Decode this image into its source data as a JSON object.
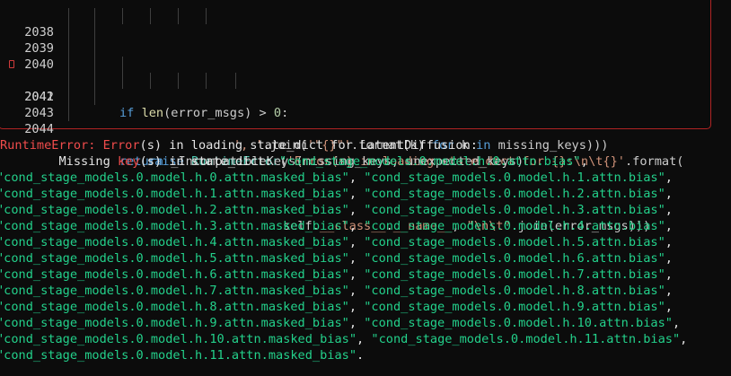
{
  "colors": {
    "border": "#b02424",
    "keyword": "#569cd6",
    "string": "#ce9178",
    "builtin": "#dcdcaa",
    "class": "#4ec9b0",
    "error": "#f14c4c",
    "key_string": "#23d18b"
  },
  "traceback": {
    "lines": [
      {
        "num": "2038",
        "seg": [
          "', '",
          ".join(",
          "'\"{}\"'",
          ".format(k) ",
          "for",
          " k ",
          "in",
          " missing_keys)))"
        ]
      },
      {
        "num": "2039"
      },
      {
        "num": "2040",
        "seg": [
          "if",
          " ",
          "len",
          "(error_msgs) > ",
          "0",
          ":"
        ]
      },
      {
        "num": "2041",
        "seg": [
          "raise",
          " ",
          "RuntimeError",
          "(",
          "'Error(s) in loading state_dict for {}:\\n\\t{}'",
          ".format("
        ]
      },
      {
        "num": "2042",
        "seg": [
          "self.",
          "__class__",
          ".",
          "__name__",
          ", ",
          "\"\\n\\t\"",
          ".join(error_msgs)))"
        ]
      },
      {
        "num": "2043",
        "seg": [
          "return",
          " _IncompatibleKeys(missing_keys, unexpected_keys)"
        ]
      },
      {
        "num": "2044"
      }
    ],
    "error_marker_icon": "error-marker-icon"
  },
  "output": {
    "error_type": "RuntimeError:",
    "error_word": "Error",
    "error_rest": "(s) in loading state_dict for LatentDiffusion:",
    "missing_prefix": "        Missing ",
    "missing_key": "key",
    "missing_rest": "(s) in state_dict: ",
    "first_key": "\"cond_stage_models.0.model.h.0.attn.bias\"",
    "first_tail": ",",
    "rows": [
      [
        "\"cond_stage_models.0.model.h.0.attn.masked_bias\"",
        ", ",
        "\"cond_stage_models.0.model.h.1.attn.bias\"",
        ","
      ],
      [
        "\"cond_stage_models.0.model.h.1.attn.masked_bias\"",
        ", ",
        "\"cond_stage_models.0.model.h.2.attn.bias\"",
        ","
      ],
      [
        "\"cond_stage_models.0.model.h.2.attn.masked_bias\"",
        ", ",
        "\"cond_stage_models.0.model.h.3.attn.bias\"",
        ","
      ],
      [
        "\"cond_stage_models.0.model.h.3.attn.masked_bias\"",
        ", ",
        "\"cond_stage_models.0.model.h.4.attn.bias\"",
        ","
      ],
      [
        "\"cond_stage_models.0.model.h.4.attn.masked_bias\"",
        ", ",
        "\"cond_stage_models.0.model.h.5.attn.bias\"",
        ","
      ],
      [
        "\"cond_stage_models.0.model.h.5.attn.masked_bias\"",
        ", ",
        "\"cond_stage_models.0.model.h.6.attn.bias\"",
        ","
      ],
      [
        "\"cond_stage_models.0.model.h.6.attn.masked_bias\"",
        ", ",
        "\"cond_stage_models.0.model.h.7.attn.bias\"",
        ","
      ],
      [
        "\"cond_stage_models.0.model.h.7.attn.masked_bias\"",
        ", ",
        "\"cond_stage_models.0.model.h.8.attn.bias\"",
        ","
      ],
      [
        "\"cond_stage_models.0.model.h.8.attn.masked_bias\"",
        ", ",
        "\"cond_stage_models.0.model.h.9.attn.bias\"",
        ","
      ],
      [
        "\"cond_stage_models.0.model.h.9.attn.masked_bias\"",
        ", ",
        "\"cond_stage_models.0.model.h.10.attn.bias\"",
        ","
      ],
      [
        "\"cond_stage_models.0.model.h.10.attn.masked_bias\"",
        ", ",
        "\"cond_stage_models.0.model.h.11.attn.bias\"",
        ","
      ],
      [
        "\"cond_stage_models.0.model.h.11.attn.masked_bias\"",
        ".",
        "",
        ""
      ]
    ]
  }
}
